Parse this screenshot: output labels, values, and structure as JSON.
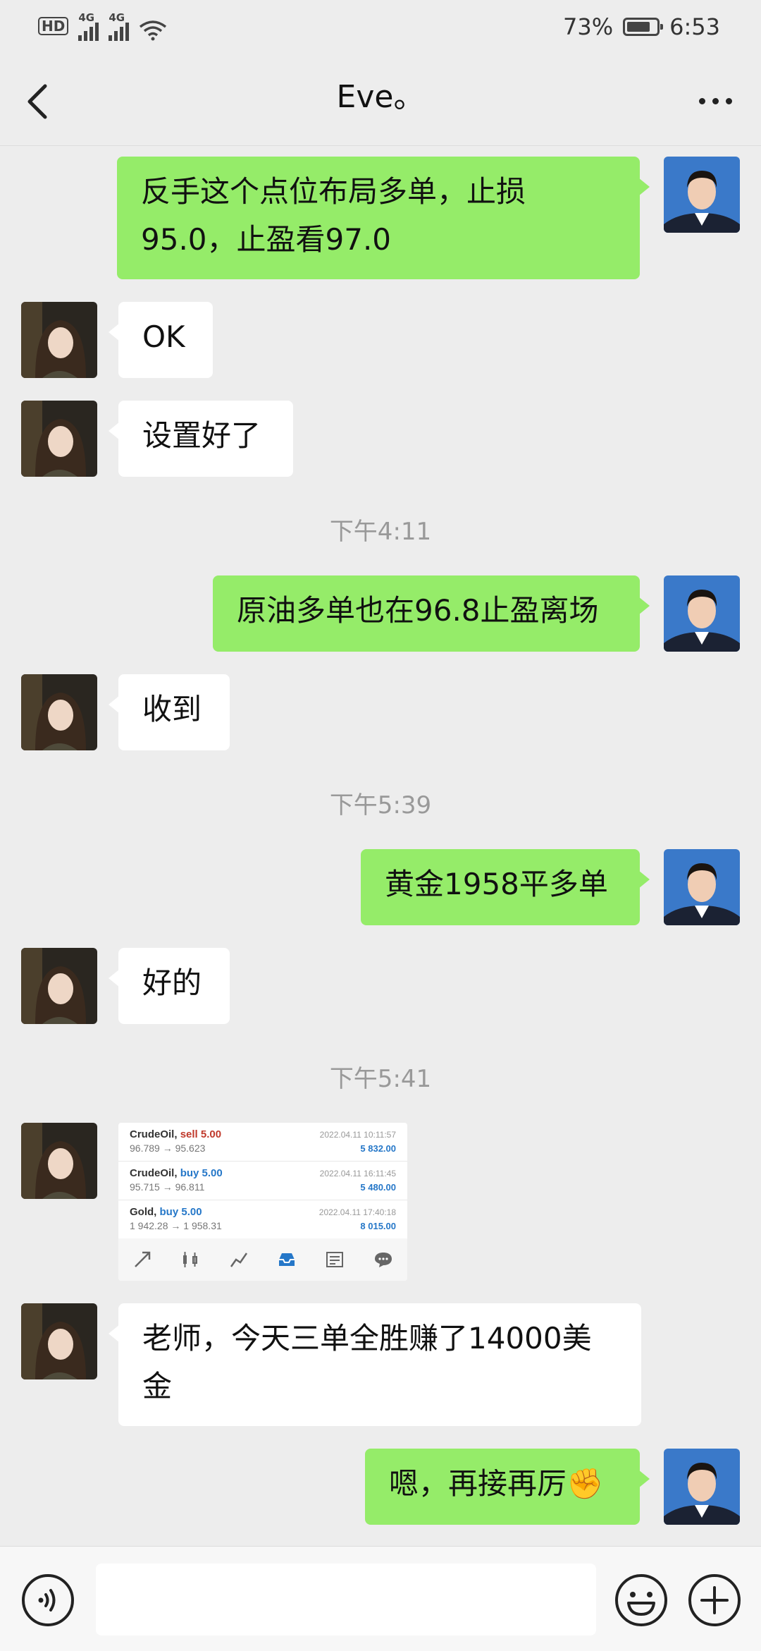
{
  "status_bar": {
    "hd_label": "HD",
    "sim1": "1",
    "net1": "4G",
    "net2": "4G",
    "battery_pct": "73%",
    "time": "6:53"
  },
  "header": {
    "title": "Eve。",
    "back_icon": "chevron-left-icon",
    "more_icon": "more-dots-icon"
  },
  "messages": [
    {
      "from": "self",
      "text": "反手这个点位布局多单，止损95.0，止盈看97.0"
    },
    {
      "from": "other",
      "text": "OK"
    },
    {
      "from": "other",
      "text": "设置好了"
    },
    {
      "type": "time",
      "text": "下午4:11"
    },
    {
      "from": "self",
      "text": "原油多单也在96.8止盈离场"
    },
    {
      "from": "other",
      "text": "收到"
    },
    {
      "type": "time",
      "text": "下午5:39"
    },
    {
      "from": "self",
      "text": "黄金1958平多单"
    },
    {
      "from": "other",
      "text": "好的"
    },
    {
      "type": "time",
      "text": "下午5:41"
    },
    {
      "from": "other",
      "type": "image"
    },
    {
      "from": "other",
      "text": "老师，今天三单全胜赚了14000美金"
    },
    {
      "from": "self",
      "text": "嗯，再接再厉✊"
    }
  ],
  "trade_screenshot": {
    "rows": [
      {
        "symbol": "CrudeOil",
        "side": "sell 5.00",
        "prices": "96.789 → 95.623",
        "date": "2022.04.11 10:11:57",
        "profit": "5 832.00"
      },
      {
        "symbol": "CrudeOil",
        "side": "buy 5.00",
        "prices": "95.715 → 96.811",
        "date": "2022.04.11 16:11:45",
        "profit": "5 480.00"
      },
      {
        "symbol": "Gold",
        "side": "buy 5.00",
        "prices": "1 942.28 → 1 958.31",
        "date": "2022.04.11 17:40:18",
        "profit": "8 015.00"
      }
    ]
  },
  "input_bar": {
    "placeholder": "",
    "voice_icon": "voice-icon",
    "emoji_icon": "emoji-icon",
    "plus_icon": "plus-icon"
  },
  "colors": {
    "self_bubble": "#95ec69",
    "other_bubble": "#ffffff",
    "background": "#ededed"
  }
}
